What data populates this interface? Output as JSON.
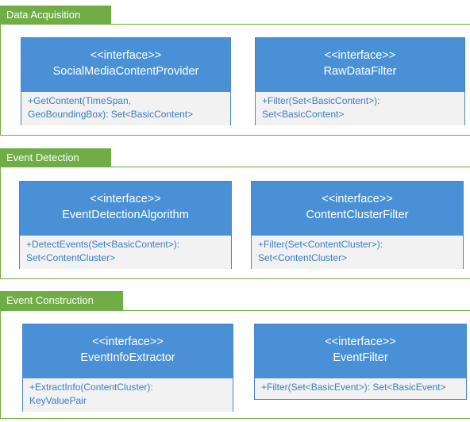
{
  "packages": [
    {
      "label": "Data Acquisition",
      "interfaces": [
        {
          "stereotype": "<<interface>>",
          "name": "SocialMediaContentProvider",
          "methods": [
            "+GetContent(TimeSpan,",
            "GeoBoundingBox): Set<BasicContent>"
          ]
        },
        {
          "stereotype": "<<interface>>",
          "name": "RawDataFilter",
          "methods": [
            "+Filter(Set<BasicContent>):",
            "Set<BasicContent>"
          ]
        }
      ]
    },
    {
      "label": "Event Detection",
      "interfaces": [
        {
          "stereotype": "<<interface>>",
          "name": "EventDetectionAlgorithm",
          "methods": [
            "+DetectEvents(Set<BasicContent>):",
            "Set<ContentCluster>"
          ]
        },
        {
          "stereotype": "<<interface>>",
          "name": "ContentClusterFilter",
          "methods": [
            "+Filter(Set<ContentCluster>):",
            "Set<ContentCluster>"
          ]
        }
      ]
    },
    {
      "label": "Event Construction",
      "interfaces": [
        {
          "stereotype": "<<interface>>",
          "name": "EventInfoExtractor",
          "methods": [
            "+ExtractInfo(ContentCluster):",
            "KeyValuePair"
          ]
        },
        {
          "stereotype": "<<interface>>",
          "name": "EventFilter",
          "methods": [
            "+Filter(Set<BasicEvent>): Set<BasicEvent>",
            ""
          ]
        }
      ]
    }
  ]
}
